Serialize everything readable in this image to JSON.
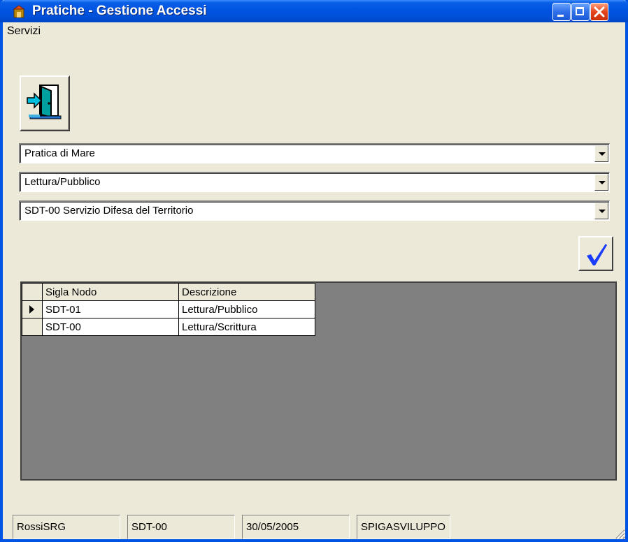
{
  "window": {
    "title": "Pratiche - Gestione Accessi",
    "controls": {
      "minimize_icon": "minimize-icon",
      "maximize_icon": "maximize-icon",
      "close_icon": "close-icon"
    }
  },
  "menu": {
    "items": [
      {
        "label": "Servizi"
      }
    ]
  },
  "toolbar": {
    "exit_icon": "exit-door-icon"
  },
  "combos": [
    {
      "value": "Pratica di Mare"
    },
    {
      "value": "Lettura/Pubblico"
    },
    {
      "value": "SDT-00 Servizio Difesa del Territorio"
    }
  ],
  "confirm": {
    "icon": "checkmark-icon"
  },
  "grid": {
    "columns": [
      "Sigla Nodo",
      "Descrizione"
    ],
    "rows": [
      {
        "current": true,
        "cells": [
          "SDT-01",
          "Lettura/Pubblico"
        ]
      },
      {
        "current": false,
        "cells": [
          "SDT-00",
          "Lettura/Scrittura"
        ]
      }
    ]
  },
  "status": {
    "user": "RossiSRG",
    "node": "SDT-00",
    "date": "30/05/2005",
    "db": "SPIGASVILUPPO"
  },
  "colors": {
    "titlebar": "#0054e3",
    "face": "#ece9d8",
    "grid_background": "#808080",
    "check": "#1a3cff"
  }
}
